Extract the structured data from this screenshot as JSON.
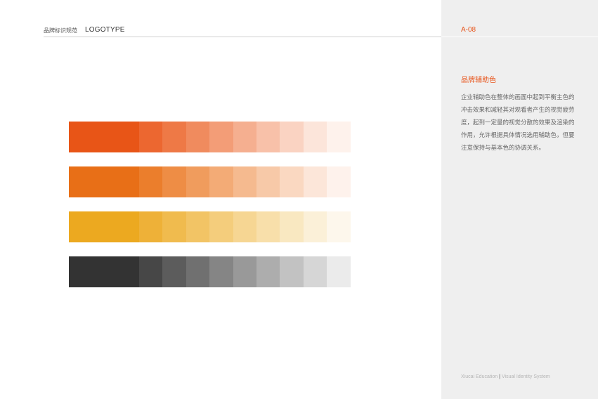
{
  "header": {
    "title_cn": "品牌标识规范",
    "title_en": "LOGOTYPE",
    "page_code": "A-08"
  },
  "section": {
    "title": "品牌辅助色",
    "body": "企业辅助色在整体的画面中起到平衡主色的冲击效果和减轻其对观看者产生的视觉疲劳度，起到一定量的视觉分散的效果及渲染的作用，允许根据具体情况选用辅助色，但要注意保持与基本色的协调关系。"
  },
  "footer": {
    "brand": "Xiucai Education",
    "separator": "|",
    "system": "Visual Identity System"
  },
  "palette": [
    {
      "name": "red-orange",
      "main": "#e85517",
      "tints": [
        "#ec6730",
        "#ee7946",
        "#f08b5e",
        "#f39d77",
        "#f5af90",
        "#f8c1a9",
        "#fad3c2",
        "#fce5da",
        "#fef2ec"
      ]
    },
    {
      "name": "orange",
      "main": "#e86f17",
      "tints": [
        "#eb7e2c",
        "#ee8d45",
        "#f09c5d",
        "#f3ab76",
        "#f5ba8f",
        "#f7c9a8",
        "#fad8c1",
        "#fce6d9",
        "#fef2ec"
      ]
    },
    {
      "name": "yellow",
      "main": "#eca920",
      "tints": [
        "#eeb138",
        "#f0bb4e",
        "#f2c465",
        "#f4cd7c",
        "#f6d693",
        "#f8dfaa",
        "#f9e8c1",
        "#fbf0d8",
        "#fdf7ec"
      ]
    },
    {
      "name": "gray",
      "main": "#333333",
      "tints": [
        "#474747",
        "#5c5c5c",
        "#707070",
        "#858585",
        "#999999",
        "#adadad",
        "#c2c2c2",
        "#d6d6d6",
        "#ebebeb"
      ]
    }
  ]
}
